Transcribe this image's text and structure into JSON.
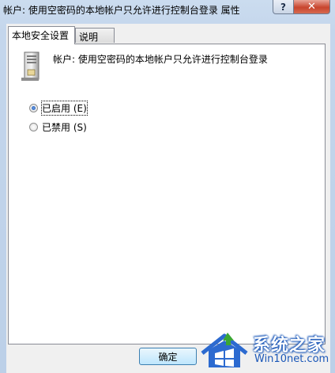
{
  "window": {
    "title": "帐户: 使用空密码的本地帐户只允许进行控制台登录 属性",
    "help_label": "?",
    "close_label": "✕"
  },
  "tabs": [
    {
      "label": "本地安全设置",
      "active": true
    },
    {
      "label": "说明",
      "active": false
    }
  ],
  "policy": {
    "icon": "server-icon",
    "title": "帐户: 使用空密码的本地帐户只允许进行控制台登录"
  },
  "options": [
    {
      "label": "已启用 (E)",
      "checked": true
    },
    {
      "label": "已禁用 (S)",
      "checked": false
    }
  ],
  "buttons": {
    "ok_label": "确定"
  },
  "watermark": {
    "brand": "系统之家",
    "url": "Win10net.com"
  },
  "colors": {
    "accent": "#1a57b8",
    "close_red": "#c8442d"
  }
}
